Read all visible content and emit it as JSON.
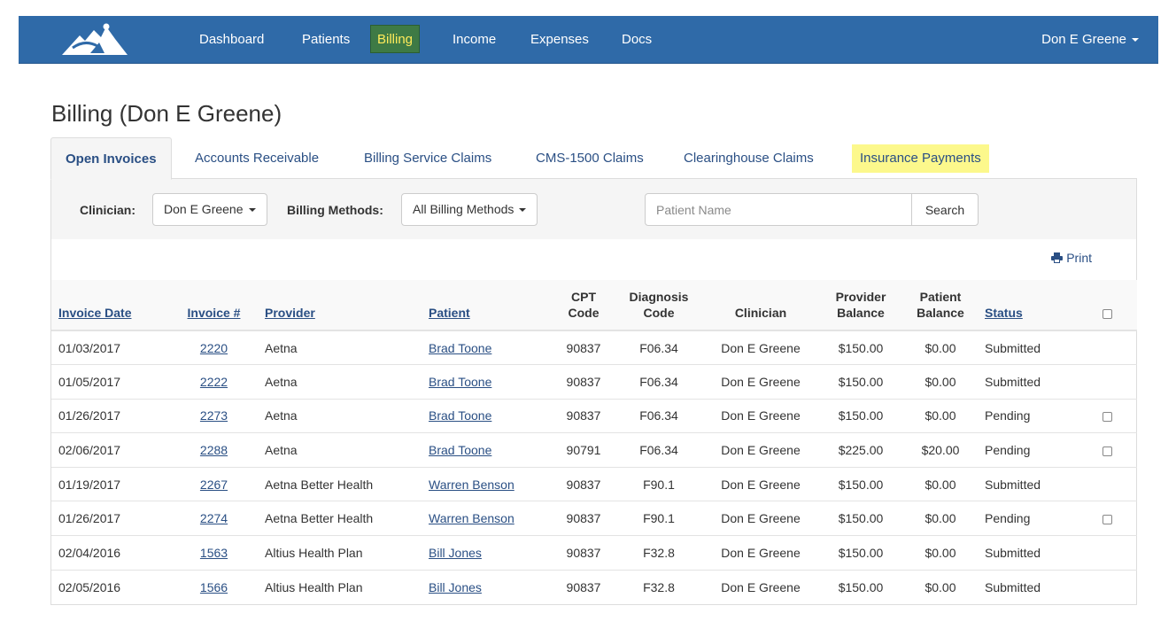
{
  "nav": {
    "logo_icon": "mountain-logo-icon",
    "items": [
      {
        "label": "Dashboard"
      },
      {
        "label": "Patients"
      },
      {
        "label": "Billing",
        "active": true
      },
      {
        "label": "Income"
      },
      {
        "label": "Expenses"
      },
      {
        "label": "Docs"
      }
    ],
    "user": "Don E Greene",
    "colors": {
      "bar": "#2f6aa8",
      "active_bg": "#3e7a45",
      "active_text": "#ffeb5a"
    }
  },
  "page": {
    "title": "Billing (Don E Greene)"
  },
  "tabs": [
    {
      "label": "Open Invoices",
      "active": true
    },
    {
      "label": "Accounts Receivable"
    },
    {
      "label": "Billing Service Claims"
    },
    {
      "label": "CMS-1500 Claims"
    },
    {
      "label": "Clearinghouse Claims"
    },
    {
      "label": "Insurance Payments",
      "highlight": "#fcf88c"
    }
  ],
  "filters": {
    "clinician_label": "Clinician:",
    "clinician_value": "Don E Greene",
    "billing_methods_label": "Billing Methods:",
    "billing_methods_value": "All Billing Methods",
    "patient_placeholder": "Patient Name",
    "search_label": "Search"
  },
  "print_label": "Print",
  "table": {
    "headers": {
      "invoice_date": "Invoice Date",
      "invoice_num": "Invoice #",
      "provider": "Provider",
      "patient": "Patient",
      "cpt_1": "CPT",
      "cpt_2": "Code",
      "diag_1": "Diagnosis",
      "diag_2": "Code",
      "clinician": "Clinician",
      "prov_bal_1": "Provider",
      "prov_bal_2": "Balance",
      "pat_bal_1": "Patient",
      "pat_bal_2": "Balance",
      "status": "Status"
    },
    "rows": [
      {
        "date": "01/03/2017",
        "invoice": "2220",
        "provider": "Aetna",
        "patient": "Brad Toone",
        "cpt": "90837",
        "diagnosis": "F06.34",
        "clinician": "Don E Greene",
        "provider_balance": "$150.00",
        "patient_balance": "$0.00",
        "status": "Submitted",
        "checkbox": false
      },
      {
        "date": "01/05/2017",
        "invoice": "2222",
        "provider": "Aetna",
        "patient": "Brad Toone",
        "cpt": "90837",
        "diagnosis": "F06.34",
        "clinician": "Don E Greene",
        "provider_balance": "$150.00",
        "patient_balance": "$0.00",
        "status": "Submitted",
        "checkbox": false
      },
      {
        "date": "01/26/2017",
        "invoice": "2273",
        "provider": "Aetna",
        "patient": "Brad Toone",
        "cpt": "90837",
        "diagnosis": "F06.34",
        "clinician": "Don E Greene",
        "provider_balance": "$150.00",
        "patient_balance": "$0.00",
        "status": "Pending",
        "checkbox": true
      },
      {
        "date": "02/06/2017",
        "invoice": "2288",
        "provider": "Aetna",
        "patient": "Brad Toone",
        "cpt": "90791",
        "diagnosis": "F06.34",
        "clinician": "Don E Greene",
        "provider_balance": "$225.00",
        "patient_balance": "$20.00",
        "status": "Pending",
        "checkbox": true
      },
      {
        "date": "01/19/2017",
        "invoice": "2267",
        "provider": "Aetna Better Health",
        "patient": "Warren Benson",
        "cpt": "90837",
        "diagnosis": "F90.1",
        "clinician": "Don E Greene",
        "provider_balance": "$150.00",
        "patient_balance": "$0.00",
        "status": "Submitted",
        "checkbox": false
      },
      {
        "date": "01/26/2017",
        "invoice": "2274",
        "provider": "Aetna Better Health",
        "patient": "Warren Benson",
        "cpt": "90837",
        "diagnosis": "F90.1",
        "clinician": "Don E Greene",
        "provider_balance": "$150.00",
        "patient_balance": "$0.00",
        "status": "Pending",
        "checkbox": true
      },
      {
        "date": "02/04/2016",
        "invoice": "1563",
        "provider": "Altius Health Plan",
        "patient": "Bill Jones",
        "cpt": "90837",
        "diagnosis": "F32.8",
        "clinician": "Don E Greene",
        "provider_balance": "$150.00",
        "patient_balance": "$0.00",
        "status": "Submitted",
        "checkbox": false
      },
      {
        "date": "02/05/2016",
        "invoice": "1566",
        "provider": "Altius Health Plan",
        "patient": "Bill Jones",
        "cpt": "90837",
        "diagnosis": "F32.8",
        "clinician": "Don E Greene",
        "provider_balance": "$150.00",
        "patient_balance": "$0.00",
        "status": "Submitted",
        "checkbox": false
      }
    ]
  }
}
